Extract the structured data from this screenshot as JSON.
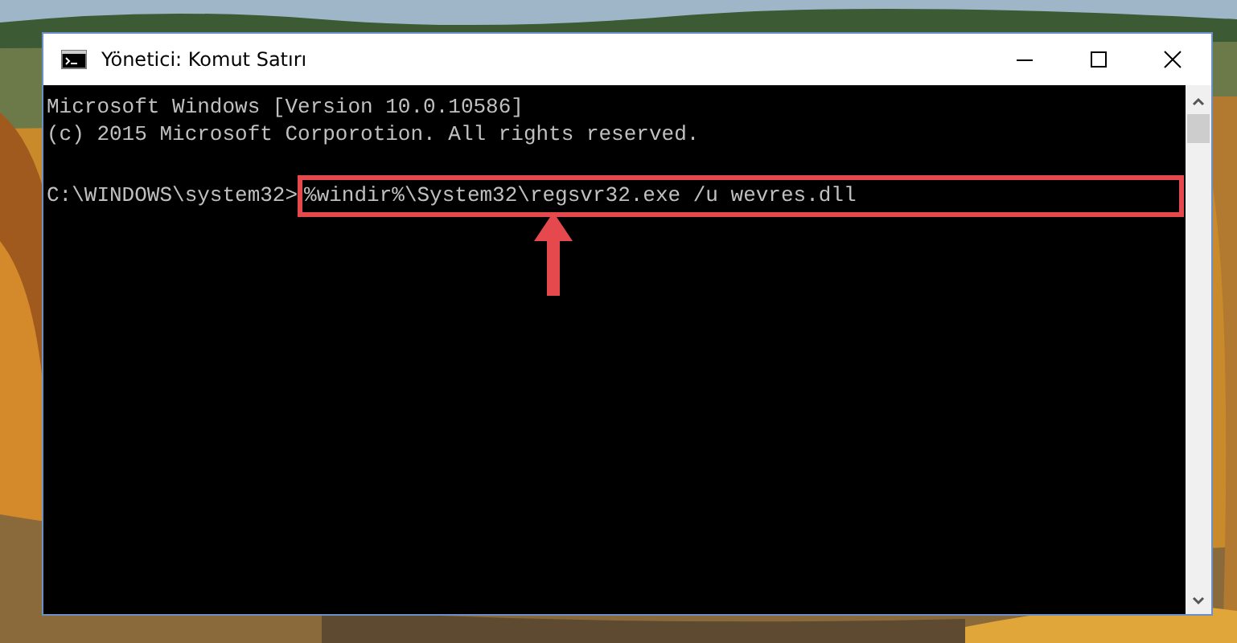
{
  "window": {
    "title": "Yönetici: Komut Satırı"
  },
  "console": {
    "lines": [
      "Microsoft Windows [Version 10.0.10586]",
      "(c) 2015 Microsoft Corporotion. All rights reserved."
    ],
    "prompt": "C:\\WINDOWS\\system32>",
    "command": "%windir%\\System32\\regsvr32.exe /u wevres.dll"
  }
}
